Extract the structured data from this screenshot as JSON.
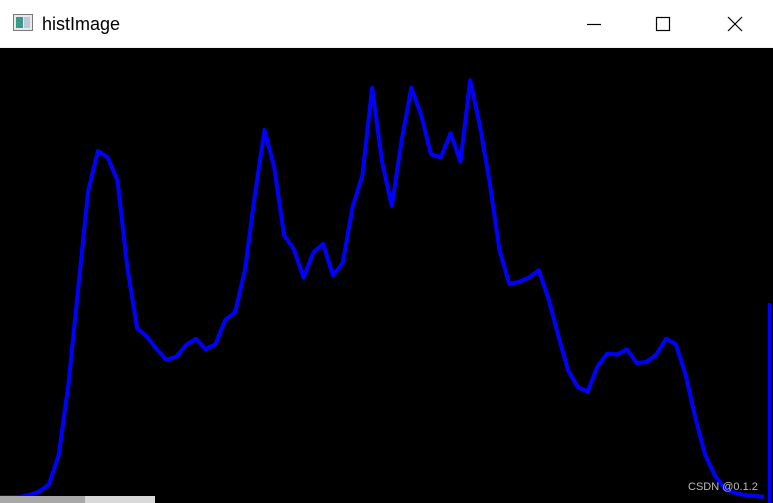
{
  "window": {
    "title": "histImage",
    "icon": "window-app-icon",
    "controls": {
      "minimize_icon": "minimize-icon",
      "maximize_icon": "maximize-icon",
      "close_icon": "close-icon"
    }
  },
  "watermark": "CSDN @0.1.2",
  "colors": {
    "titlebar_bg": "#ffffff",
    "canvas_bg": "#000000",
    "histogram_line": "#0000ff",
    "watermark": "#bdbdbd"
  },
  "chart_data": {
    "type": "line",
    "x": [
      0,
      4,
      8,
      12,
      16,
      20,
      24,
      28,
      32,
      36,
      40,
      44,
      48,
      52,
      56,
      60,
      64,
      68,
      72,
      76,
      80,
      84,
      88,
      92,
      96,
      100,
      104,
      108,
      112,
      116,
      120,
      124,
      128,
      132,
      136,
      140,
      144,
      148,
      152,
      156,
      160,
      164,
      168,
      172,
      176,
      180,
      184,
      188,
      192,
      196,
      200,
      204,
      208,
      212,
      216,
      220,
      224,
      228,
      232,
      236,
      240,
      244,
      248,
      252,
      255
    ],
    "values": [
      0,
      0,
      0,
      2,
      5,
      12,
      40,
      108,
      200,
      290,
      328,
      322,
      300,
      218,
      160,
      152,
      140,
      130,
      133,
      144,
      150,
      140,
      145,
      168,
      175,
      215,
      285,
      348,
      312,
      248,
      235,
      208,
      232,
      240,
      210,
      222,
      275,
      305,
      388,
      318,
      276,
      338,
      388,
      362,
      325,
      322,
      345,
      318,
      395,
      352,
      298,
      234,
      202,
      204,
      208,
      215,
      188,
      153,
      120,
      104,
      100,
      124,
      136,
      135,
      140,
      127,
      128,
      135,
      150,
      145,
      116,
      75,
      40,
      20,
      8,
      4,
      2,
      1,
      0
    ],
    "ylim": [
      0,
      420
    ],
    "xlim": [
      0,
      255
    ],
    "grid": false,
    "legend": "none"
  }
}
